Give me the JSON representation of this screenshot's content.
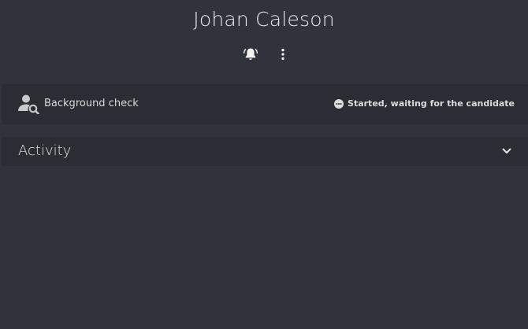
{
  "candidate": {
    "name": "Johan Caleson"
  },
  "toolbar": {
    "notifications_icon": "bell-ring-icon",
    "more_icon": "more-vertical-icon"
  },
  "background_check": {
    "label": "Background check",
    "icon": "user-search-icon",
    "status_icon": "ellipsis-circle-icon",
    "status": "Started, waiting for the candidate"
  },
  "activity": {
    "title": "Activity",
    "toggle_icon": "chevron-down-icon"
  },
  "colors": {
    "background": "#30333b",
    "card": "#2a2d33",
    "text": "#e6e6e6",
    "icon": "#c9c9cc"
  }
}
